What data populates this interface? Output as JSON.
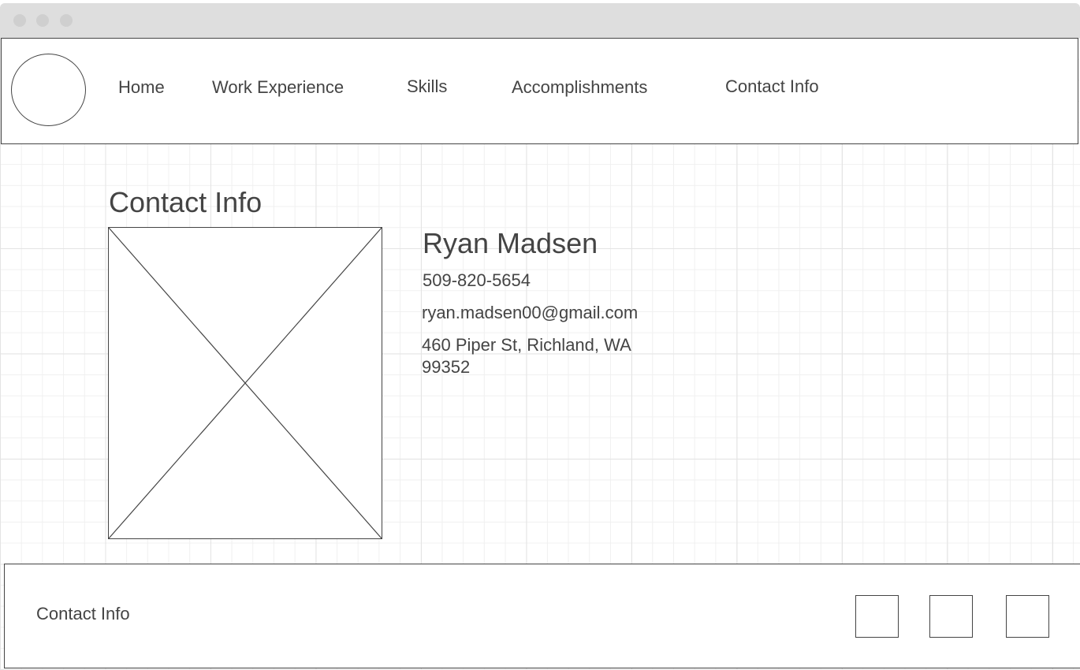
{
  "nav": {
    "items": [
      {
        "label": "Home"
      },
      {
        "label": "Work Experience"
      },
      {
        "label": "Skills"
      },
      {
        "label": "Accomplishments"
      },
      {
        "label": "Contact Info"
      }
    ]
  },
  "main": {
    "section_title": "Contact Info",
    "name": "Ryan Madsen",
    "phone": "509-820-5654",
    "email": "ryan.madsen00@gmail.com",
    "address_line1": "460 Piper St, Richland, WA",
    "address_line2": "99352"
  },
  "footer": {
    "title": "Contact Info",
    "icons": [
      "social-link-1-icon",
      "social-link-2-icon",
      "social-link-3-icon"
    ]
  },
  "colors": {
    "stroke": "#444444",
    "grid": "#e4e4e4",
    "titlebar": "#dedede"
  }
}
